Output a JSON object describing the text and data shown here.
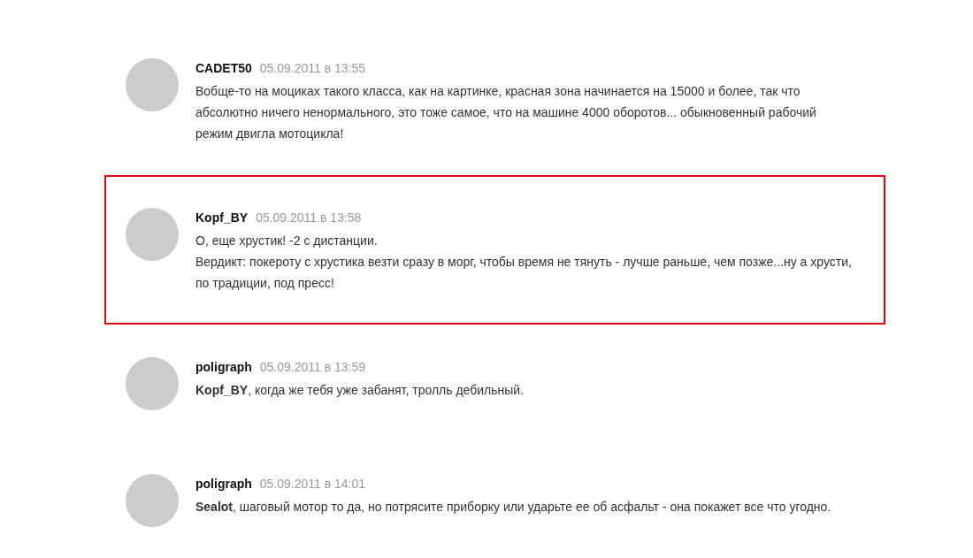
{
  "comments": [
    {
      "author": "CADET50",
      "date": "05.09.2011 в 13:55",
      "highlighted": false,
      "paragraphs": [
        "Вобще-то на моциках такого класса, как на картинке, красная зона начинается на 15000 и более, так что абсолютно ничего ненормального, это тоже самое, что на машине 4000 оборотов... обыкновенный рабочий режим двигла мотоцикла!"
      ]
    },
    {
      "author": "Kopf_BY",
      "date": "05.09.2011 в 13:58",
      "highlighted": true,
      "paragraphs": [
        "О, еще хрустик! -2 с дистанции.",
        "Вердикт: покероту с хрустика везти сразу в морг, чтобы время не тянуть - лучше раньше, чем позже...ну а хрусти, по традиции, под пресс!"
      ]
    },
    {
      "author": "poligraph",
      "date": "05.09.2011 в 13:59",
      "highlighted": false,
      "paragraphs": [
        "**Kopf_BY**, когда же тебя уже забанят, тролль дебильный."
      ]
    },
    {
      "author": "poligraph",
      "date": "05.09.2011 в 14:01",
      "highlighted": false,
      "paragraphs": [
        "**Sealot**, шаговый мотор то да, но потрясите приборку или ударьте ее об асфальт - она покажет все что угодно."
      ]
    }
  ]
}
